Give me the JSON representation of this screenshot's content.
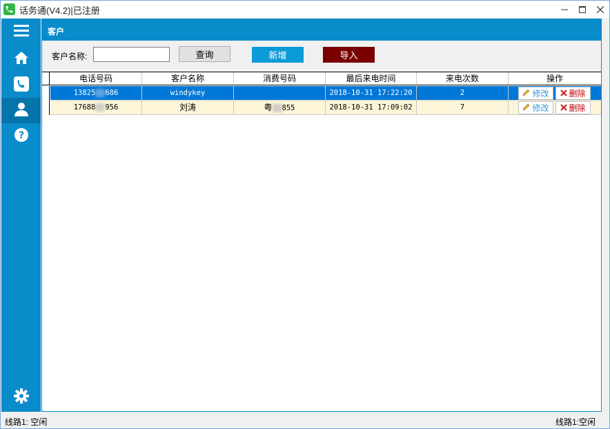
{
  "window": {
    "title": "话务通(V4.2)|已注册"
  },
  "header": {
    "title": "客户"
  },
  "toolbar": {
    "search_label": "客户名称:",
    "search_value": "",
    "query_label": "查询",
    "add_label": "新增",
    "import_label": "导入"
  },
  "table": {
    "columns": [
      "电话号码",
      "客户名称",
      "消费号码",
      "最后来电时间",
      "来电次数",
      "操作"
    ],
    "rows": [
      {
        "phone_prefix": "13825",
        "phone_suffix": "686",
        "name": "windykey",
        "consume_prefix": "",
        "consume_suffix": "",
        "last_call": "2018-10-31 17:22:20",
        "count": "2",
        "selected": true
      },
      {
        "phone_prefix": "17688",
        "phone_suffix": "956",
        "name": "刘涛",
        "consume_prefix": "粤",
        "consume_suffix": "855",
        "last_call": "2018-10-31 17:09:02",
        "count": "7",
        "selected": false
      }
    ],
    "edit_label": "修改",
    "delete_label": "删除"
  },
  "status": {
    "left": "线路1: 空闲",
    "right": "线路1:空闲"
  },
  "colors": {
    "sidebar": "#0a8ccb",
    "selected_row": "#0078d7",
    "row_bg": "#fdf5d7",
    "import_button": "#7a0000",
    "add_button": "#0a9bd8"
  },
  "icons": {
    "sidebar": [
      "menu-icon",
      "home-icon",
      "phone-icon",
      "user-icon",
      "help-icon",
      "settings-icon"
    ]
  }
}
